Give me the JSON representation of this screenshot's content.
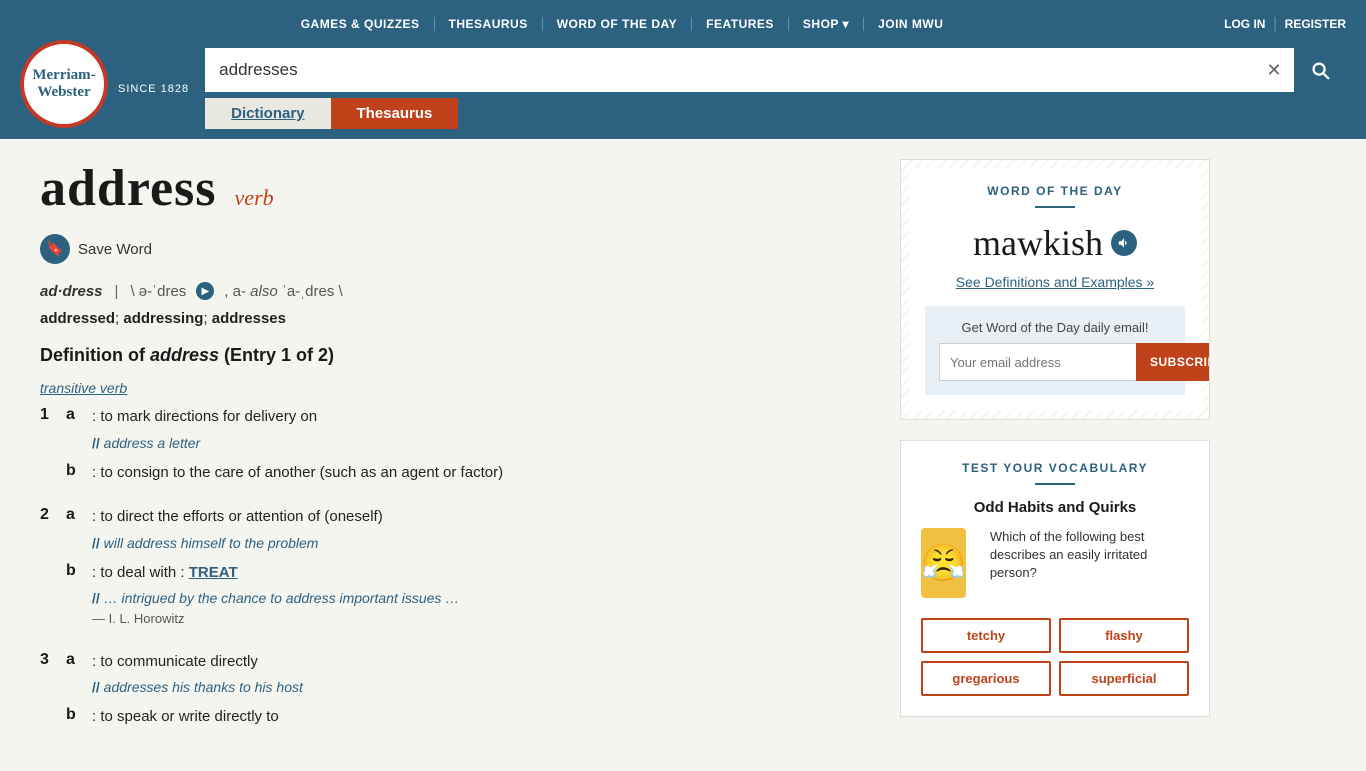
{
  "header": {
    "logo_line1": "Merriam-",
    "logo_line2": "Webster",
    "since": "SINCE 1828",
    "nav_links": [
      {
        "label": "GAMES & QUIZZES",
        "id": "games-quizzes"
      },
      {
        "label": "THESAURUS",
        "id": "thesaurus-nav"
      },
      {
        "label": "WORD OF THE DAY",
        "id": "word-of-day-nav"
      },
      {
        "label": "FEATURES",
        "id": "features-nav"
      },
      {
        "label": "SHOP ▾",
        "id": "shop-nav"
      },
      {
        "label": "JOIN MWU",
        "id": "join-nav"
      }
    ],
    "auth_links": [
      {
        "label": "LOG IN",
        "id": "login"
      },
      {
        "label": "REGISTER",
        "id": "register"
      }
    ],
    "search_value": "addresses",
    "tab_dictionary": "Dictionary",
    "tab_thesaurus": "Thesaurus"
  },
  "article": {
    "word": "address",
    "pos": "verb",
    "save_label": "Save Word",
    "pronunciation_word": "ad·dress",
    "pronunciation_phonetic": "ə-ˈdres",
    "pronunciation_alt": "a- also ˈa-ˌdres",
    "inflections_label": "addressed",
    "inflections": [
      "addressed",
      "addressing",
      "addresses"
    ],
    "definition_heading": "Definition of address (Entry 1 of 2)",
    "definition_word_italic": "address",
    "pos_label": "transitive verb",
    "definitions": [
      {
        "num": "1",
        "senses": [
          {
            "letter": "a",
            "text": ": to mark directions for delivery on",
            "example": "// address a letter",
            "example_word": "address"
          },
          {
            "letter": "b",
            "text": ": to consign to the care of another (such as an agent or factor)",
            "example": null
          }
        ]
      },
      {
        "num": "2",
        "senses": [
          {
            "letter": "a",
            "text": ": to direct the efforts or attention of (oneself)",
            "example": "// will address himself to the problem",
            "example_word": "address"
          },
          {
            "letter": "b",
            "text": ": to deal with : TREAT",
            "treat_link": "TREAT",
            "example": "// … intrigued by the chance to address important issues …",
            "example_word": "address",
            "attribution": "— I. L. Horowitz"
          }
        ]
      },
      {
        "num": "3",
        "senses": [
          {
            "letter": "a",
            "text": ": to communicate directly",
            "example": "// addresses his thanks to his host",
            "example_word": "addresses"
          },
          {
            "letter": "b",
            "text": ": to speak or write directly to",
            "example": null
          }
        ]
      }
    ]
  },
  "wotd": {
    "label": "WORD OF THE DAY",
    "word": "mawkish",
    "see_link": "See Definitions and Examples",
    "email_label": "Get Word of the Day daily email!",
    "email_placeholder": "Your email address",
    "subscribe_label": "SUBSCRIBE"
  },
  "vocab": {
    "label": "TEST YOUR VOCABULARY",
    "title": "Odd Habits and Quirks",
    "question": "Which of the following best describes an easily irritated person?",
    "emoji": "😤",
    "choices": [
      "tetchy",
      "flashy",
      "gregarious",
      "superficial"
    ]
  }
}
